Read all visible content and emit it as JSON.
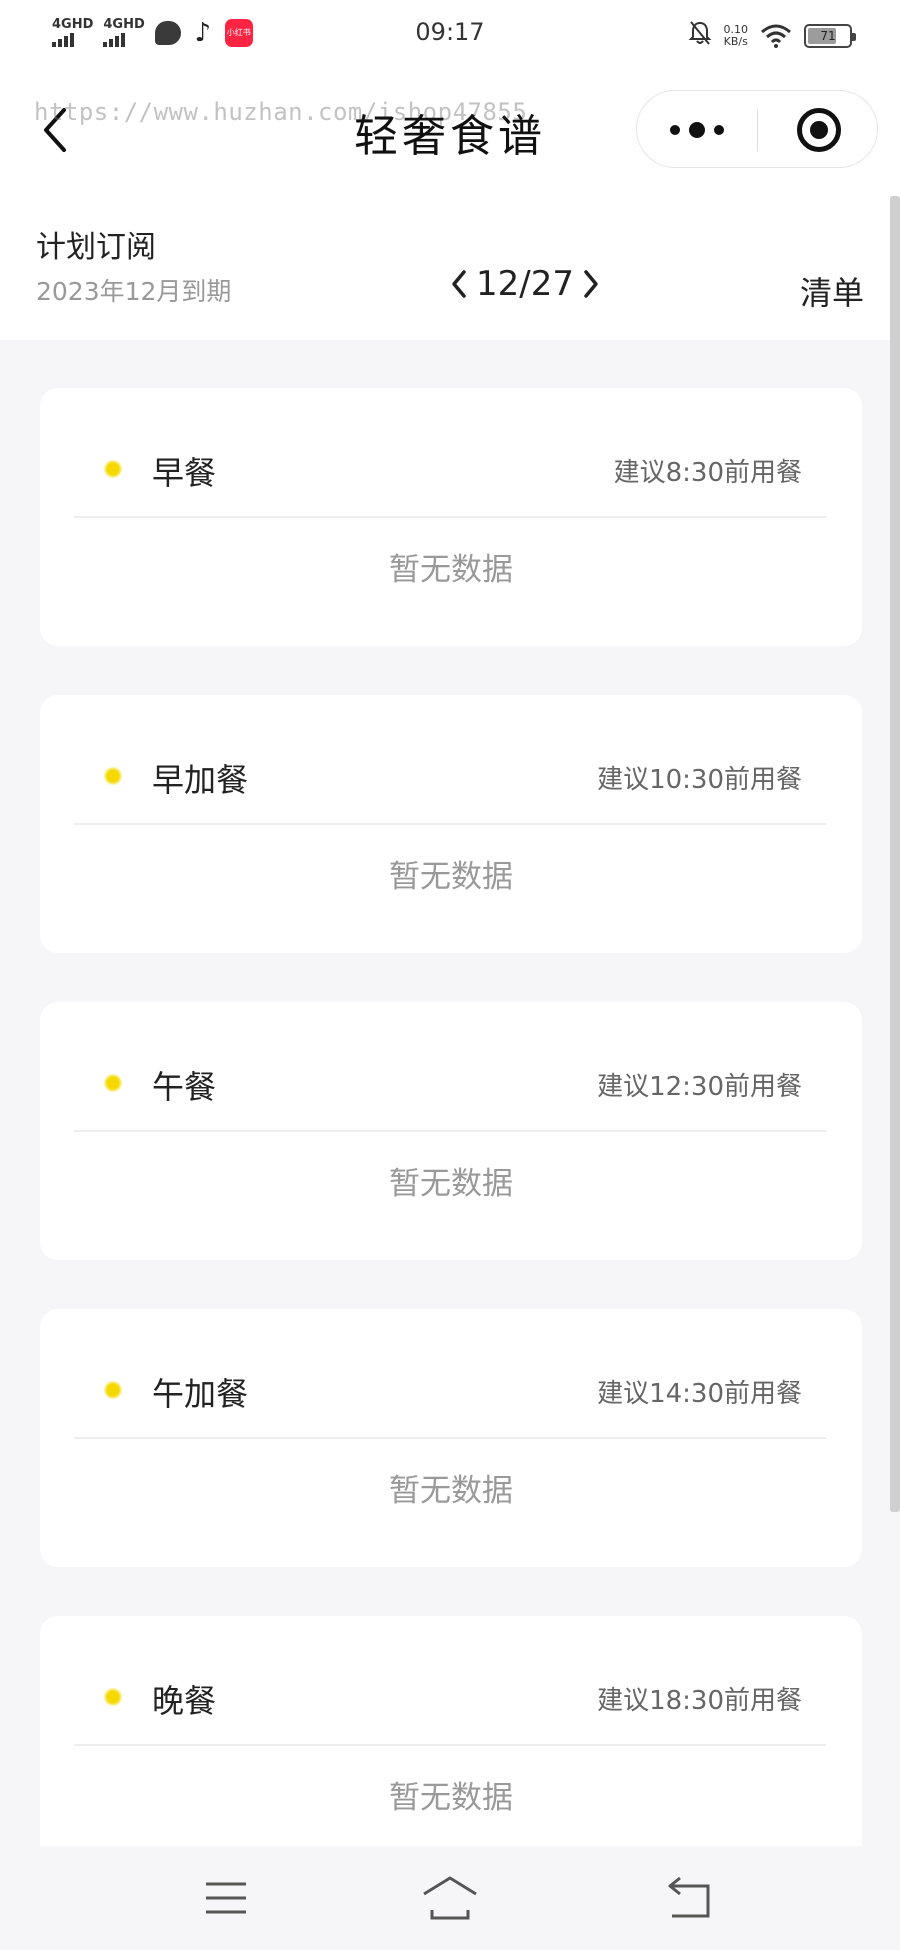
{
  "status_bar": {
    "signal1_label": "4GHD",
    "signal2_label": "4GHD",
    "xhs_label": "小红书",
    "time": "09:17",
    "net_speed_value": "0.10",
    "net_speed_unit": "KB/s",
    "battery": "71",
    "battery_level": 0.71
  },
  "nav": {
    "watermark": "https://www.huzhan.com/ishop47855",
    "title": "轻奢食谱"
  },
  "subscription": {
    "title": "计划订阅",
    "expire": "2023年12月到期",
    "date": "12/27",
    "list_label": "清单"
  },
  "meals": [
    {
      "name": "早餐",
      "tip": "建议8:30前用餐",
      "empty": "暂无数据"
    },
    {
      "name": "早加餐",
      "tip": "建议10:30前用餐",
      "empty": "暂无数据"
    },
    {
      "name": "午餐",
      "tip": "建议12:30前用餐",
      "empty": "暂无数据"
    },
    {
      "name": "午加餐",
      "tip": "建议14:30前用餐",
      "empty": "暂无数据"
    },
    {
      "name": "晚餐",
      "tip": "建议18:30前用餐",
      "empty": "暂无数据"
    }
  ],
  "colors": {
    "accent_dot": "#f5d800",
    "page_background": "#f6f6f8",
    "card_background": "#ffffff",
    "muted_text": "#999999"
  }
}
